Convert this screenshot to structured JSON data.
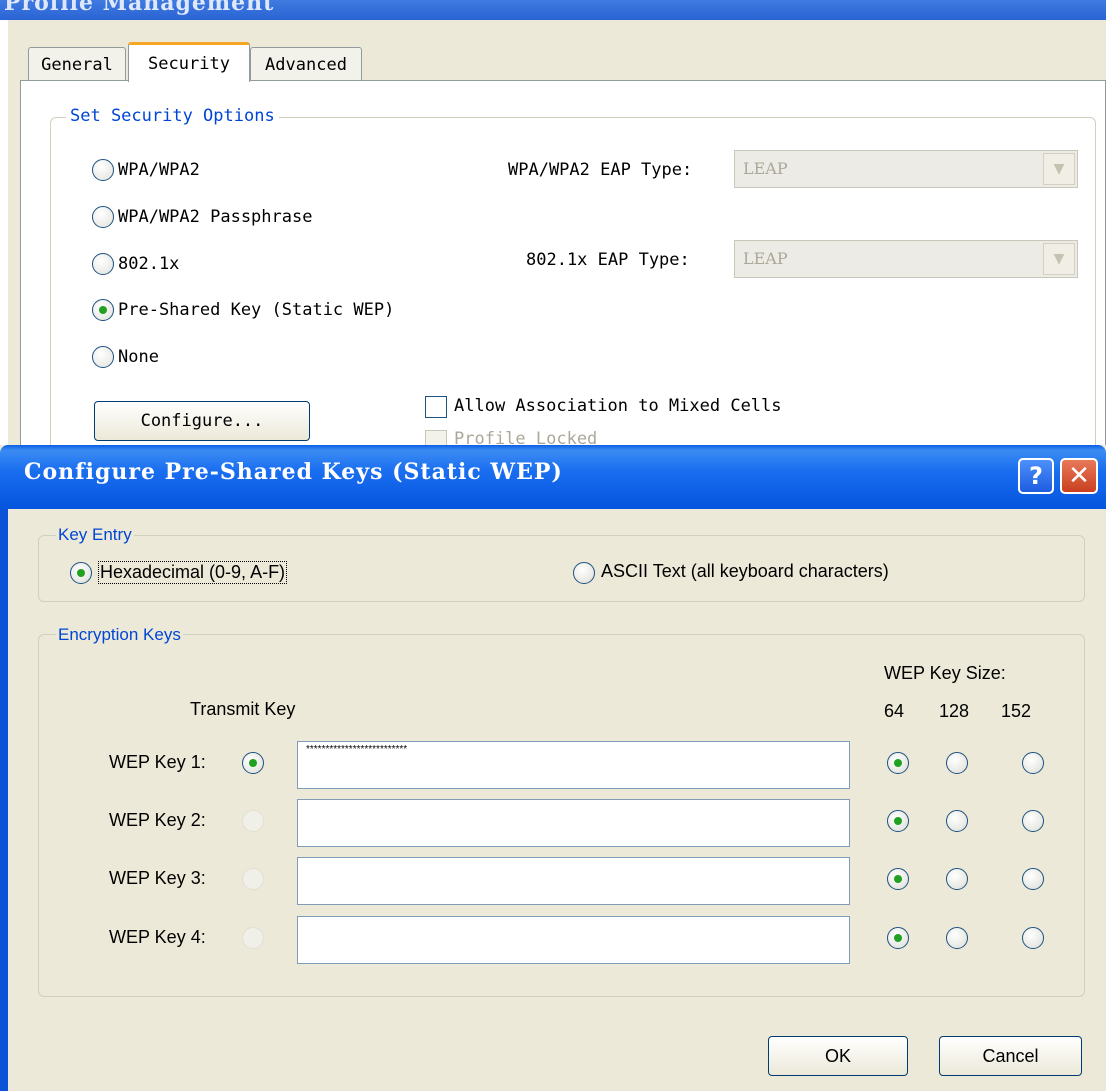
{
  "background_window": {
    "title": "Profile Management",
    "tabs": [
      "General",
      "Security",
      "Advanced"
    ],
    "active_tab": "Security",
    "group_label": "Set Security Options",
    "options": [
      {
        "label": "WPA/WPA2",
        "checked": false
      },
      {
        "label": "WPA/WPA2 Passphrase",
        "checked": false
      },
      {
        "label": "802.1x",
        "checked": false
      },
      {
        "label": "Pre-Shared Key (Static WEP)",
        "checked": true
      },
      {
        "label": "None",
        "checked": false
      }
    ],
    "wpa_eap_label": "WPA/WPA2 EAP Type:",
    "wpa_eap_value": "LEAP",
    "dot1x_eap_label": "802.1x EAP Type:",
    "dot1x_eap_value": "LEAP",
    "configure_label": "Configure...",
    "mixed_cells_label": "Allow Association to Mixed Cells",
    "profile_locked_label": "Profile Locked"
  },
  "dialog": {
    "title": "Configure Pre-Shared Keys (Static WEP)",
    "help_glyph": "?",
    "close_glyph": "✕",
    "key_entry": {
      "label": "Key Entry",
      "hex_label": "Hexadecimal (0-9, A-F)",
      "ascii_label": "ASCII Text (all keyboard characters)",
      "selected": "hex"
    },
    "encryption_keys": {
      "label": "Encryption Keys",
      "transmit_key_header": "Transmit Key",
      "key_size_header": "WEP Key Size:",
      "size_columns": [
        "64",
        "128",
        "152"
      ],
      "keys": [
        {
          "label": "WEP Key 1:",
          "value": "**************************",
          "transmit": true,
          "size": "64"
        },
        {
          "label": "WEP Key 2:",
          "value": "",
          "transmit": false,
          "size": "64"
        },
        {
          "label": "WEP Key 3:",
          "value": "",
          "transmit": false,
          "size": "64"
        },
        {
          "label": "WEP Key 4:",
          "value": "",
          "transmit": false,
          "size": "64"
        }
      ]
    },
    "ok_label": "OK",
    "cancel_label": "Cancel"
  }
}
